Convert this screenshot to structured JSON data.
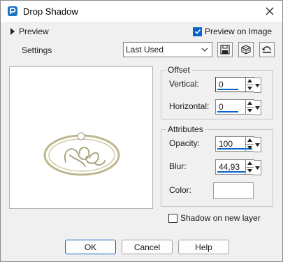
{
  "window": {
    "title": "Drop Shadow",
    "close_icon": "close-icon",
    "app_icon": "paintshop-icon"
  },
  "preview": {
    "toggle_label": "Preview",
    "preview_on_image_label": "Preview on Image",
    "preview_on_image_checked": true
  },
  "settings": {
    "label": "Settings",
    "preset_value": "Last Used",
    "buttons": [
      "save-preset-icon",
      "randomize-icon",
      "reset-icon"
    ]
  },
  "offset": {
    "legend": "Offset",
    "vertical_label": "Vertical:",
    "vertical_value": "0",
    "horizontal_label": "Horizontal:",
    "horizontal_value": "0"
  },
  "attributes": {
    "legend": "Attributes",
    "opacity_label": "Opacity:",
    "opacity_value": "100",
    "blur_label": "Blur:",
    "blur_value": "44,93",
    "color_label": "Color:",
    "color_value": "#ffffff"
  },
  "shadow_on_new_layer": {
    "label": "Shadow on new layer",
    "checked": false
  },
  "footer": {
    "ok_label": "OK",
    "cancel_label": "Cancel",
    "help_label": "Help"
  },
  "colors": {
    "accent": "#0a63c9",
    "frame_gold": "#bdb78f"
  }
}
